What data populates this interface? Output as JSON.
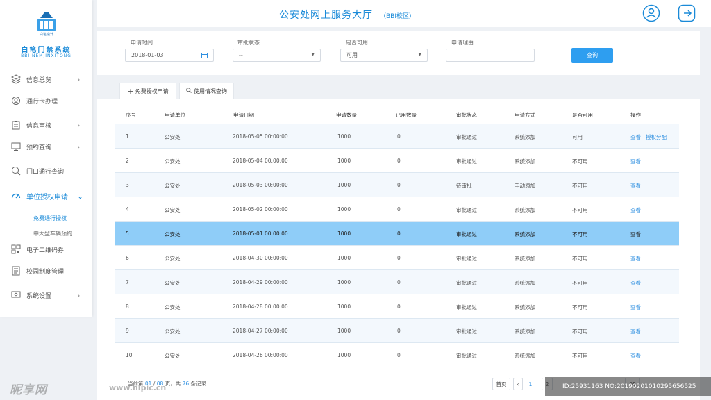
{
  "app": {
    "logo_text": "白笔设计",
    "title": "白笔门禁系统",
    "subtitle": "BBI NEMJINXITONG",
    "header_title": "公安处网上服务大厅",
    "header_subtitle": "（BBI校区）",
    "brand_color": "#1a8ad8"
  },
  "sidebar": {
    "items": [
      {
        "label": "信息总览",
        "icon": "layers-icon",
        "has_chevron": true
      },
      {
        "label": "通行卡办理",
        "icon": "card-icon",
        "has_chevron": false
      },
      {
        "label": "信息审核",
        "icon": "clipboard-icon",
        "has_chevron": true
      },
      {
        "label": "预约查询",
        "icon": "monitor-icon",
        "has_chevron": true
      },
      {
        "label": "门口通行查询",
        "icon": "search-icon",
        "has_chevron": false
      },
      {
        "label": "单位授权申请",
        "icon": "speedometer-icon",
        "has_chevron": true,
        "active": true
      },
      {
        "label": "电子二维码券",
        "icon": "qrcode-icon",
        "has_chevron": false
      },
      {
        "label": "校园制度管理",
        "icon": "document-icon",
        "has_chevron": false
      },
      {
        "label": "系统设置",
        "icon": "settings-monitor-icon",
        "has_chevron": true
      }
    ],
    "subitems": [
      {
        "label": "免费通行授权",
        "active": true
      },
      {
        "label": "中大型车辆预约",
        "active": false
      }
    ],
    "chevron_right": "›",
    "chevron_down": "⌄"
  },
  "filters": {
    "date_label": "申请时间",
    "date_value": "2018-01-03",
    "status_label": "审批状态",
    "status_value": "--",
    "available_label": "是否可用",
    "available_value": "可用",
    "reason_label": "申请理由",
    "reason_value": "",
    "query_button": "查询"
  },
  "tabs": [
    {
      "label": "免费授权申请",
      "icon": "plus-icon"
    },
    {
      "label": "使用情况查询",
      "icon": "search-icon"
    }
  ],
  "table": {
    "columns": [
      "序号",
      "申请单位",
      "申请日期",
      "申请数量",
      "已用数量",
      "审批状态",
      "申请方式",
      "是否可用",
      "操作"
    ],
    "rows": [
      {
        "no": "1",
        "unit": "公安处",
        "date": "2018-05-05  00:00:00",
        "qty": "1000",
        "used": "0",
        "status": "审批通过",
        "method": "系统添加",
        "available": "可用",
        "action": "查看",
        "action2": "授权分配"
      },
      {
        "no": "2",
        "unit": "公安处",
        "date": "2018-05-04  00:00:00",
        "qty": "1000",
        "used": "0",
        "status": "审批通过",
        "method": "系统添加",
        "available": "不可用",
        "action": "查看",
        "action2": ""
      },
      {
        "no": "3",
        "unit": "公安处",
        "date": "2018-05-03  00:00:00",
        "qty": "1000",
        "used": "0",
        "status": "待审批",
        "method": "手动添加",
        "available": "不可用",
        "action": "查看",
        "action2": ""
      },
      {
        "no": "4",
        "unit": "公安处",
        "date": "2018-05-02  00:00:00",
        "qty": "1000",
        "used": "0",
        "status": "审批通过",
        "method": "系统添加",
        "available": "不可用",
        "action": "查看",
        "action2": ""
      },
      {
        "no": "5",
        "unit": "公安处",
        "date": "2018-05-01  00:00:00",
        "qty": "1000",
        "used": "0",
        "status": "审批通过",
        "method": "系统添加",
        "available": "不可用",
        "action": "查看",
        "action2": "",
        "selected": true
      },
      {
        "no": "6",
        "unit": "公安处",
        "date": "2018-04-30  00:00:00",
        "qty": "1000",
        "used": "0",
        "status": "审批通过",
        "method": "系统添加",
        "available": "不可用",
        "action": "查看",
        "action2": ""
      },
      {
        "no": "7",
        "unit": "公安处",
        "date": "2018-04-29  00:00:00",
        "qty": "1000",
        "used": "0",
        "status": "审批通过",
        "method": "系统添加",
        "available": "不可用",
        "action": "查看",
        "action2": ""
      },
      {
        "no": "8",
        "unit": "公安处",
        "date": "2018-04-28  00:00:00",
        "qty": "1000",
        "used": "0",
        "status": "审批通过",
        "method": "系统添加",
        "available": "不可用",
        "action": "查看",
        "action2": ""
      },
      {
        "no": "9",
        "unit": "公安处",
        "date": "2018-04-27  00:00:00",
        "qty": "1000",
        "used": "0",
        "status": "审批通过",
        "method": "系统添加",
        "available": "不可用",
        "action": "查看",
        "action2": ""
      },
      {
        "no": "10",
        "unit": "公安处",
        "date": "2018-04-26  00:00:00",
        "qty": "1000",
        "used": "0",
        "status": "审批通过",
        "method": "系统添加",
        "available": "不可用",
        "action": "查看",
        "action2": ""
      }
    ]
  },
  "pager": {
    "prefix": "当前第",
    "current": "01",
    "sep": "/",
    "total_pages": "08",
    "mid": "页，共",
    "total_records": "76",
    "suffix": "条记录",
    "first": "首页",
    "prev": "‹",
    "page1": "1",
    "page2": "2",
    "page_last": "08"
  },
  "overlay": {
    "watermark": "昵享网",
    "watermark_url": "www.nipic.cn",
    "id_text": "ID:25931163 NO:20190201010295656525"
  }
}
